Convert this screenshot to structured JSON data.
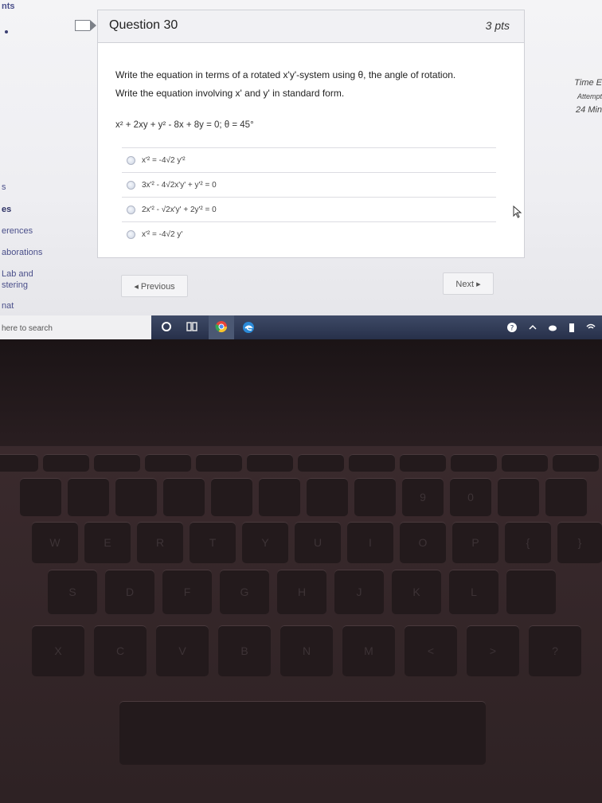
{
  "left_nav": [
    "nts",
    "s",
    "es",
    "erences",
    "aborations",
    "Lab and",
    "stering",
    "nat"
  ],
  "question": {
    "title": "Question 30",
    "points": "3 pts",
    "prompt_line1": "Write the equation in terms of a rotated x'y'-system using θ, the angle of rotation.",
    "prompt_line2": "Write the equation involving x' and y' in standard form.",
    "equation": "x² + 2xy + y² - 8x + 8y = 0; θ = 45°",
    "answers": [
      "x'² = -4√2 y'²",
      "3x'² - 4√2x'y' + y'² = 0",
      "2x'² - √2x'y' + 2y'² = 0",
      "x'² = -4√2 y'"
    ]
  },
  "buttons": {
    "previous": "◂ Previous",
    "next": "Next ▸"
  },
  "timer": {
    "line1": "Time E",
    "line2": "Attempt",
    "line3": "24 Min"
  },
  "taskbar": {
    "search_placeholder": "here to search"
  },
  "keyboard_rows": [
    [
      "",
      "",
      "",
      "",
      "",
      "",
      "",
      "",
      "",
      "",
      "",
      ""
    ],
    [
      "",
      "",
      "",
      "",
      "",
      "",
      "",
      "",
      "9",
      "0",
      "",
      ""
    ],
    [
      "W",
      "E",
      "R",
      "T",
      "Y",
      "U",
      "I",
      "O",
      "P",
      "{",
      "}"
    ],
    [
      "S",
      "D",
      "F",
      "G",
      "H",
      "J",
      "K",
      "L",
      ""
    ],
    [
      "X",
      "C",
      "V",
      "B",
      "N",
      "M",
      "<",
      ">",
      "?"
    ]
  ]
}
